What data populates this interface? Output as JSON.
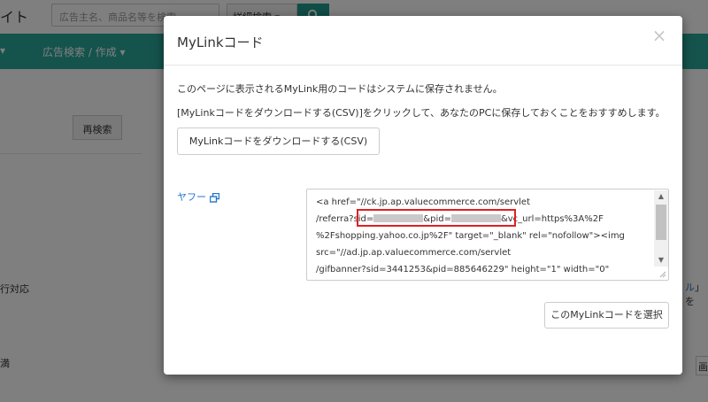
{
  "background": {
    "site_title_fragment": "イト",
    "search": {
      "placeholder": "広告主名、商品名等を検索"
    },
    "advanced_search_label": "詳細検索 ▾",
    "nav": {
      "fragment_label": "▾",
      "ad_search_label": "広告検索 / 作成 ▾"
    },
    "research_button_label": "再検索",
    "left_text_1": "行対応",
    "left_text_2": "満",
    "right_fragment_blue": "ル",
    "right_fragment_suffix": "」を",
    "right_box_label": "画"
  },
  "modal": {
    "title": "MyLinkコード",
    "close_label": "×",
    "message_1": "このページに表示されるMyLink用のコードはシステムに保存されません。",
    "message_2": "[MyLinkコードをダウンロードする(CSV)]をクリックして、あなたのPCに保存しておくことをおすすめします。",
    "download_button_label": "MyLinkコードをダウンロードする(CSV)",
    "link_label": "ヤフー",
    "code": {
      "line1": "<a href=\"//ck.jp.ap.valuecommerce.com/servlet",
      "line2_a": "/referra",
      "line2_b": "?sid=",
      "line2_c": "&pid=",
      "line2_d": "&",
      "line2_e": "vc_url=https%3A%2F",
      "line3": "%2Fshopping.yahoo.co.jp%2F\" target=\"_blank\" rel=\"nofollow\"><img",
      "line4": "src=\"//ad.jp.ap.valuecommerce.com/servlet",
      "line5": "/gifbanner?sid=3441253&pid=885646229\" height=\"1\" width=\"0\""
    },
    "select_button_label": "このMyLinkコードを選択"
  },
  "colors": {
    "accent_teal": "#2aa79b",
    "link_blue": "#2277cc",
    "highlight_red": "#e02020"
  }
}
